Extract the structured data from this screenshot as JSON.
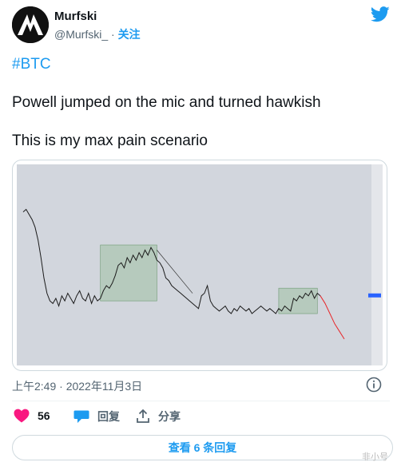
{
  "user": {
    "name": "Murfski",
    "handle": "@Murfski_",
    "separator": "·",
    "follow_label": "关注"
  },
  "tweet": {
    "hashtag": "#BTC",
    "line1": "Powell jumped on the mic and turned hawkish",
    "line2": "This is my max pain scenario"
  },
  "timestamp": "上午2:49 · 2022年11月3日",
  "actions": {
    "likes": "56",
    "reply_label": "回复",
    "share_label": "分享"
  },
  "more_replies_label": "查看 6 条回复",
  "watermark": "非小号",
  "colors": {
    "accent": "#1d9bf0",
    "like": "#f91880",
    "box": "#9fc1a3",
    "projection": "#e8272a"
  },
  "chart_data": {
    "type": "line",
    "series": [
      {
        "values": [
          56,
          57,
          55,
          53,
          50,
          45,
          38,
          30,
          24,
          21,
          20,
          22,
          19,
          23,
          21,
          24,
          22,
          20,
          23,
          25,
          22,
          21,
          24,
          20,
          23,
          21,
          22,
          25,
          27,
          26,
          28,
          31,
          35,
          36,
          34,
          38,
          36,
          39,
          37,
          40,
          38,
          41,
          39,
          42,
          40,
          37,
          36,
          34,
          30,
          29,
          27,
          26,
          25,
          24,
          23,
          22,
          21,
          20,
          19,
          18,
          23,
          24,
          27,
          21,
          19,
          18,
          17,
          18,
          19,
          17,
          16,
          18,
          17,
          19,
          18,
          17,
          18,
          16,
          17,
          18,
          19,
          18,
          17,
          18,
          17,
          16,
          18,
          17,
          19,
          18,
          17,
          22,
          21,
          23,
          22,
          24,
          23,
          25,
          22,
          24,
          23
        ]
      }
    ],
    "projection": [
      23,
      20,
      16,
      12,
      9,
      6
    ],
    "boxes": [
      {
        "range": [
          26,
          45
        ]
      },
      {
        "range": [
          86,
          99
        ]
      }
    ],
    "ylim": [
      0,
      70
    ]
  }
}
